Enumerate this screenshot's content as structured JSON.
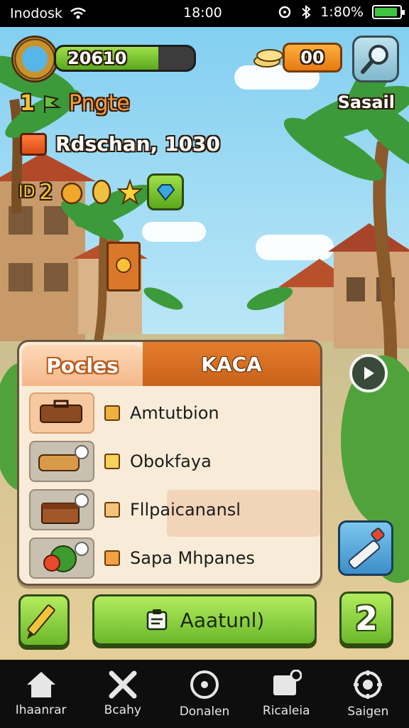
{
  "status_bar": {
    "carrier": "Inodosk",
    "time": "18:00",
    "battery_text": "1:80%",
    "battery_level": 0.9
  },
  "hud": {
    "xp_value": "20610",
    "xp_fill_percent": 74,
    "coins": "00",
    "player_name": "Sasail",
    "level_prefix": "1",
    "level_name": "Pngte",
    "date_label": "Rdschan, 1030",
    "items_count": "2",
    "items_prefix": "ID"
  },
  "panel": {
    "tabs": [
      {
        "label": "Pocles",
        "active": true
      },
      {
        "label": "KACA",
        "active": false
      }
    ],
    "rows": [
      {
        "label": "Amtutbion",
        "icon": "suitcase-icon",
        "highlighted": false
      },
      {
        "label": "Obokfaya",
        "icon": "scroll-icon",
        "highlighted": false
      },
      {
        "label": "Fllpaicanansl",
        "icon": "treasure-chest-icon",
        "highlighted": true
      },
      {
        "label": "Sapa Mhpanes",
        "icon": "fruit-icon",
        "highlighted": false
      }
    ]
  },
  "actions": {
    "main_button": "Aaatunl)",
    "counter": "2"
  },
  "bottom_nav": [
    {
      "label": "Ihaanrar",
      "icon": "home-icon"
    },
    {
      "label": "Bcahy",
      "icon": "cross-tools-icon"
    },
    {
      "label": "Donalen",
      "icon": "clock-icon"
    },
    {
      "label": "Ricaleia",
      "icon": "notification-icon"
    },
    {
      "label": "Saigen",
      "icon": "settings-icon"
    }
  ],
  "colors": {
    "accent_orange": "#e47d2c",
    "accent_green": "#6ab82a",
    "panel_bg": "#f8ecd8",
    "nav_bg": "#0e0e0e"
  }
}
